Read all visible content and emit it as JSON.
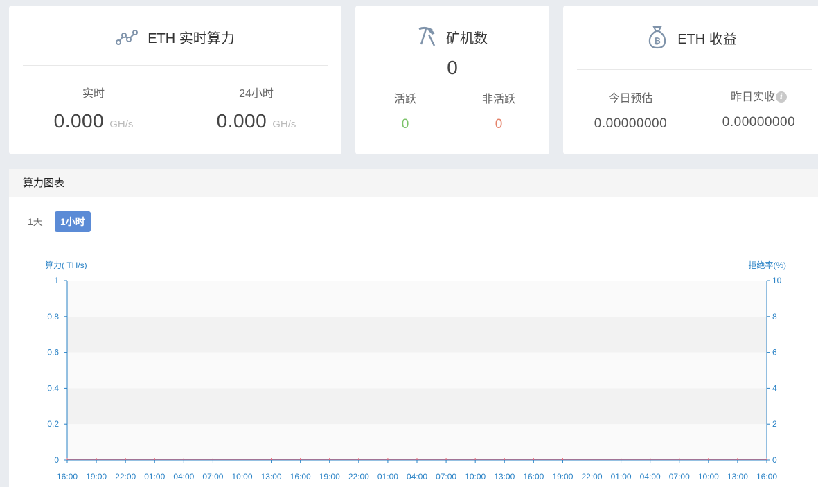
{
  "hashrate_card": {
    "title": "ETH 实时算力",
    "icon": "line-chart-icon",
    "realtime_label": "实时",
    "realtime_value": "0.000",
    "realtime_unit": "GH/s",
    "avg24_label": "24小时",
    "avg24_value": "0.000",
    "avg24_unit": "GH/s"
  },
  "miners_card": {
    "title": "矿机数",
    "icon": "pickaxe-icon",
    "total": "0",
    "active_label": "活跃",
    "active_value": "0",
    "active_color": "#7cc36a",
    "inactive_label": "非活跃",
    "inactive_value": "0",
    "inactive_color": "#e4826a"
  },
  "earnings_card": {
    "title": "ETH 收益",
    "icon": "bitcoin-bag-icon",
    "today_label": "今日预估",
    "today_value": "0.00000000",
    "yesterday_label": "昨日实收",
    "yesterday_info": "i",
    "yesterday_value": "0.00000000"
  },
  "chart_panel": {
    "title": "算力图表",
    "ranges": [
      "1天",
      "1小时"
    ],
    "selected_range": "1小时"
  },
  "chart_data": {
    "type": "line",
    "ylabel_left": "算力( TH/s)",
    "ylabel_right": "拒绝率(%)",
    "ylim_left": [
      0,
      1
    ],
    "ylim_right": [
      0,
      10
    ],
    "yticks_left": [
      "0",
      "0.2",
      "0.4",
      "0.6",
      "0.8",
      "1"
    ],
    "yticks_right": [
      "0",
      "2",
      "4",
      "6",
      "8",
      "10"
    ],
    "x": [
      "16:00",
      "19:00",
      "22:00",
      "01:00",
      "04:00",
      "07:00",
      "10:00",
      "13:00",
      "16:00",
      "19:00",
      "22:00",
      "01:00",
      "04:00",
      "07:00",
      "10:00",
      "13:00",
      "16:00",
      "19:00",
      "22:00",
      "01:00",
      "04:00",
      "07:00",
      "10:00",
      "13:00",
      "16:00"
    ],
    "series": [
      {
        "values": [
          0,
          0,
          0,
          0,
          0,
          0,
          0,
          0,
          0,
          0,
          0,
          0,
          0,
          0,
          0,
          0,
          0,
          0,
          0,
          0,
          0,
          0,
          0,
          0,
          0
        ],
        "color": "#e86a7a"
      }
    ],
    "grid": "alternating bands",
    "axis_color": "#2b83c6"
  }
}
